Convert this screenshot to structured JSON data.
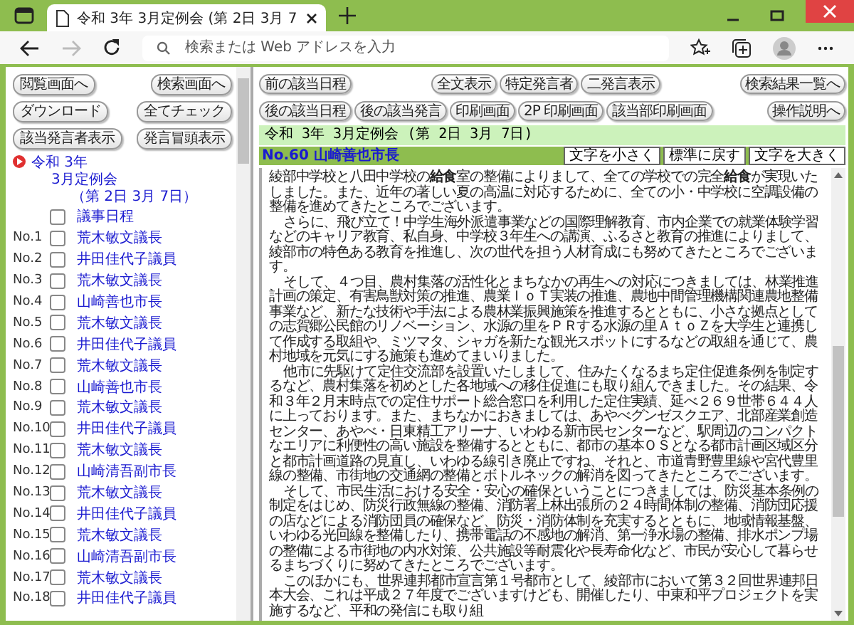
{
  "browser": {
    "tab_title": "令和 3年 3月定例会 (第 2日 3月 7",
    "address_placeholder": "検索または Web アドレスを入力",
    "forward_disabled": true
  },
  "left": {
    "button_rows": [
      [
        "閲覧画面へ",
        "検索画面へ"
      ],
      [
        "ダウンロード",
        "全てチェック"
      ],
      [
        "該当発言者表示",
        "発言冒頭表示"
      ]
    ],
    "tree": [
      {
        "label": "令和 3年",
        "children": [
          {
            "label": "3月定例会",
            "children": [
              {
                "label": "（第 2日 3月 7日）"
              }
            ]
          }
        ]
      }
    ],
    "items": [
      {
        "label": "議事日程",
        "checked": false
      },
      {
        "number": "No.1",
        "label": "荒木敏文議長",
        "checked": false
      },
      {
        "number": "No.2",
        "label": "井田佳代子議員",
        "checked": false
      },
      {
        "number": "No.3",
        "label": "荒木敏文議長",
        "checked": false
      },
      {
        "number": "No.4",
        "label": "山崎善也市長",
        "checked": false
      },
      {
        "number": "No.5",
        "label": "荒木敏文議長",
        "checked": false
      },
      {
        "number": "No.6",
        "label": "井田佳代子議員",
        "checked": false
      },
      {
        "number": "No.7",
        "label": "荒木敏文議長",
        "checked": false
      },
      {
        "number": "No.8",
        "label": "山崎善也市長",
        "checked": false
      },
      {
        "number": "No.9",
        "label": "荒木敏文議長",
        "checked": false
      },
      {
        "number": "No.10",
        "label": "井田佳代子議員",
        "checked": false
      },
      {
        "number": "No.11",
        "label": "荒木敏文議長",
        "checked": false
      },
      {
        "number": "No.12",
        "label": "山崎清吾副市長",
        "checked": false
      },
      {
        "number": "No.13",
        "label": "荒木敏文議長",
        "checked": false
      },
      {
        "number": "No.14",
        "label": "井田佳代子議員",
        "checked": false
      },
      {
        "number": "No.15",
        "label": "荒木敏文議長",
        "checked": false
      },
      {
        "number": "No.16",
        "label": "山崎清吾副市長",
        "checked": false
      },
      {
        "number": "No.17",
        "label": "荒木敏文議長",
        "checked": false
      },
      {
        "number": "No.18",
        "label": "井田佳代子議員",
        "checked": false
      }
    ]
  },
  "right": {
    "nav_rows": [
      [
        [
          "前の該当日程"
        ],
        [
          "全文表示",
          "特定発言者",
          "二発言表示"
        ],
        [
          "検索結果一覧へ"
        ]
      ],
      [
        [
          "後の該当日程",
          "後の該当発言",
          "印刷画面",
          "2P 印刷画面",
          "該当部印刷画面"
        ],
        [
          "操作説明へ"
        ]
      ]
    ],
    "session_title": "令和 3年 3月定例会 (第 2日 3月 7日)",
    "speaker": "No.60 山崎善也市長",
    "font_buttons": [
      "文字を小さく",
      "標準に戻す",
      "文字を大きく"
    ],
    "paragraphs": [
      "綾部中学校と八田中学校の**給食**室の整備によりまして、全ての学校での完全**給食**が実現いたしました。また、近年の著しい夏の高温に対応するために、全ての小・中学校に空調設備の整備を進めてきたところでございます。",
      "さらに、飛び立て！中学生海外派遣事業などの国際理解教育、市内企業での就業体験学習などのキャリア教育、私自身、中学校３年生への講演、ふるさと教育の推進によりまして、綾部市の特色ある教育を推進し、次の世代を担う人材育成にも努めてきたところでございます。",
      "そして、４つ目、農村集落の活性化とまちなかの再生への対応につきましては、林業推進計画の策定、有害鳥獣対策の推進、農業ＩｏＴ実装の推進、農地中間管理機構関連農地整備事業など、新たな技術や手法による農林業振興施策を推進するとともに、小さな拠点としての志賀郷公民館のリノベーション、水源の里をＰＲする水源の里ＡｔｏＺを大学生と連携して作成する取組や、ミツマタ、シャガを新たな観光スポットにするなどの取組を通じて、農村地域を元気にする施策も進めてまいりました。",
      "他市に先駆けて定住交流部を設置いたしまして、住みたくなるまち定住促進条例を制定するなど、農村集落を初めとした各地域への移住促進にも取り組んできました。その結果、令和３年２月末時点での定住サポート総合窓口を利用した定住実績、延べ２６９世帯６４４人に上っております。また、まちなかにおきましては、あやべグンゼスクエア、北部産業創造センター、あやべ・日東精工アリーナ、いわゆる新市民センターなど、駅周辺のコンパクトなエリアに利便性の高い施設を整備するとともに、都市の基本ＯＳとなる都市計画区域区分と都市計画道路の見直し、いわゆる線引き廃止ですね、それと、市道青野豊里線や宮代豊里線の整備、市街地の交通網の整備とボトルネックの解消を図ってきたところでございます。",
      "そして、市民生活における安全・安心の確保ということにつきましては、防災基本条例の制定をはじめ、防災行政無線の整備、消防署上林出張所の２４時間体制の整備、消防団応援の店などによる消防団員の確保など、防災・消防体制を充実するとともに、地域情報基盤、いわゆる光回線を整備したり、携帯電話の不感地の解消、第一浄水場の整備、排水ポンプ場の整備による市街地の内水対策、公共施設等耐震化や長寿命化など、市民が安心して暮らせるまちづくりに努めてきたところでございます。",
      "このほかにも、世界連邦都市宣言第１号都市として、綾部市において第３２回世界連邦日本大会、これは平成２７年度でございますけども、開催したり、中東和平プロジェクトを実施するなど、平和の発信にも取り組"
    ]
  }
}
